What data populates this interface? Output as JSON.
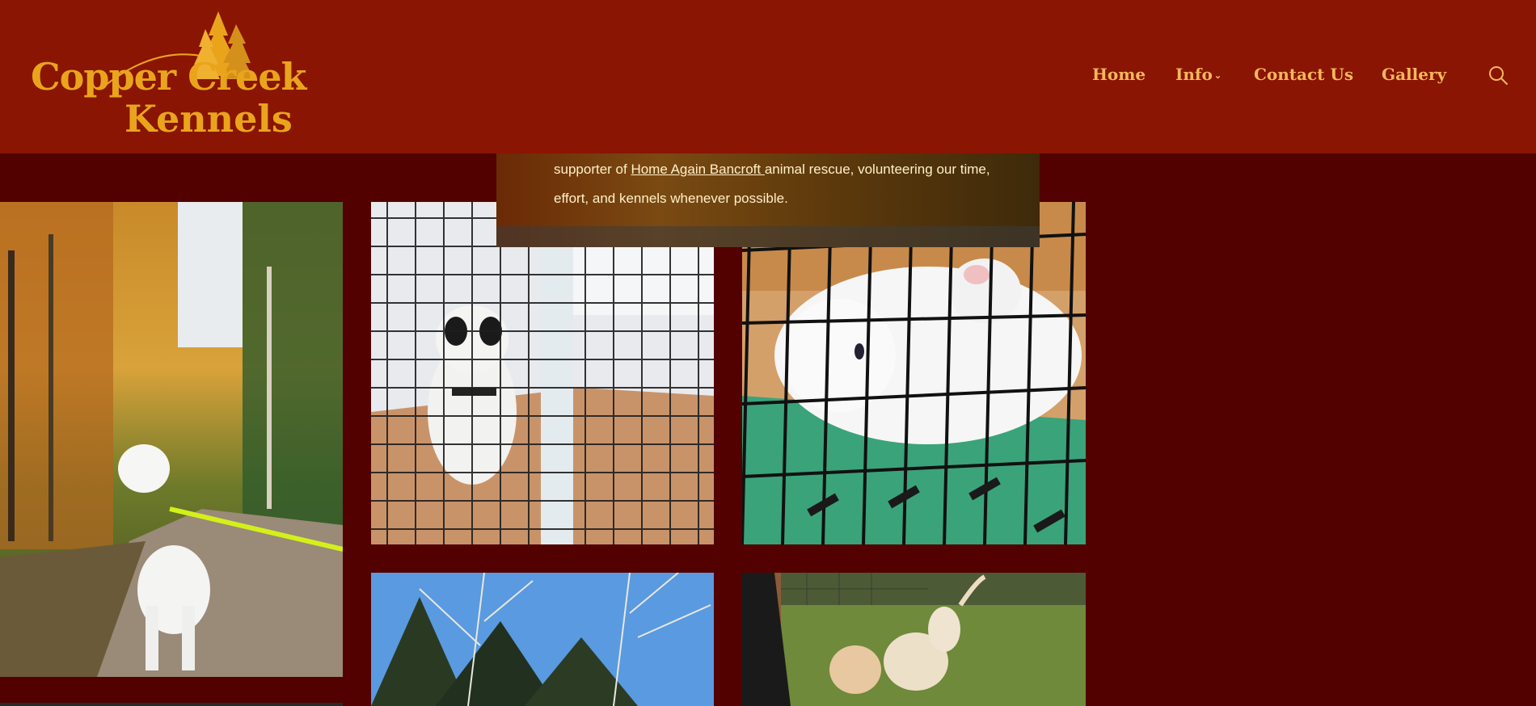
{
  "brand": {
    "name_line1": "Copper Creek",
    "name_line2": "Kennels",
    "logo_icon": "pine-trees-arc-icon"
  },
  "nav": {
    "items": [
      {
        "label": "Home"
      },
      {
        "label": "Info",
        "icon": "chevron-down-icon"
      },
      {
        "label": "Contact Us"
      },
      {
        "label": "Gallery"
      }
    ],
    "search_icon": "search-icon"
  },
  "intro": {
    "text_before": "supporter of ",
    "link_text": "Home Again Bancroft ",
    "text_after": "animal rescue, volunteering our time, effort, and kennels whenever possible."
  },
  "colors": {
    "header_bg": "#8a1502",
    "page_bg": "#520000",
    "accent": "#e9a41c",
    "nav_text": "#f3b85c"
  },
  "gallery": {
    "photos": [
      {
        "subject": "white dog on leash on autumn forest path"
      },
      {
        "subject": "black and white dog behind wire crate"
      },
      {
        "subject": "white cat in wire crate on green carrier"
      },
      {
        "subject": "birch trees against blue sky"
      },
      {
        "subject": "two yellow labrador puppies on grass"
      }
    ]
  }
}
